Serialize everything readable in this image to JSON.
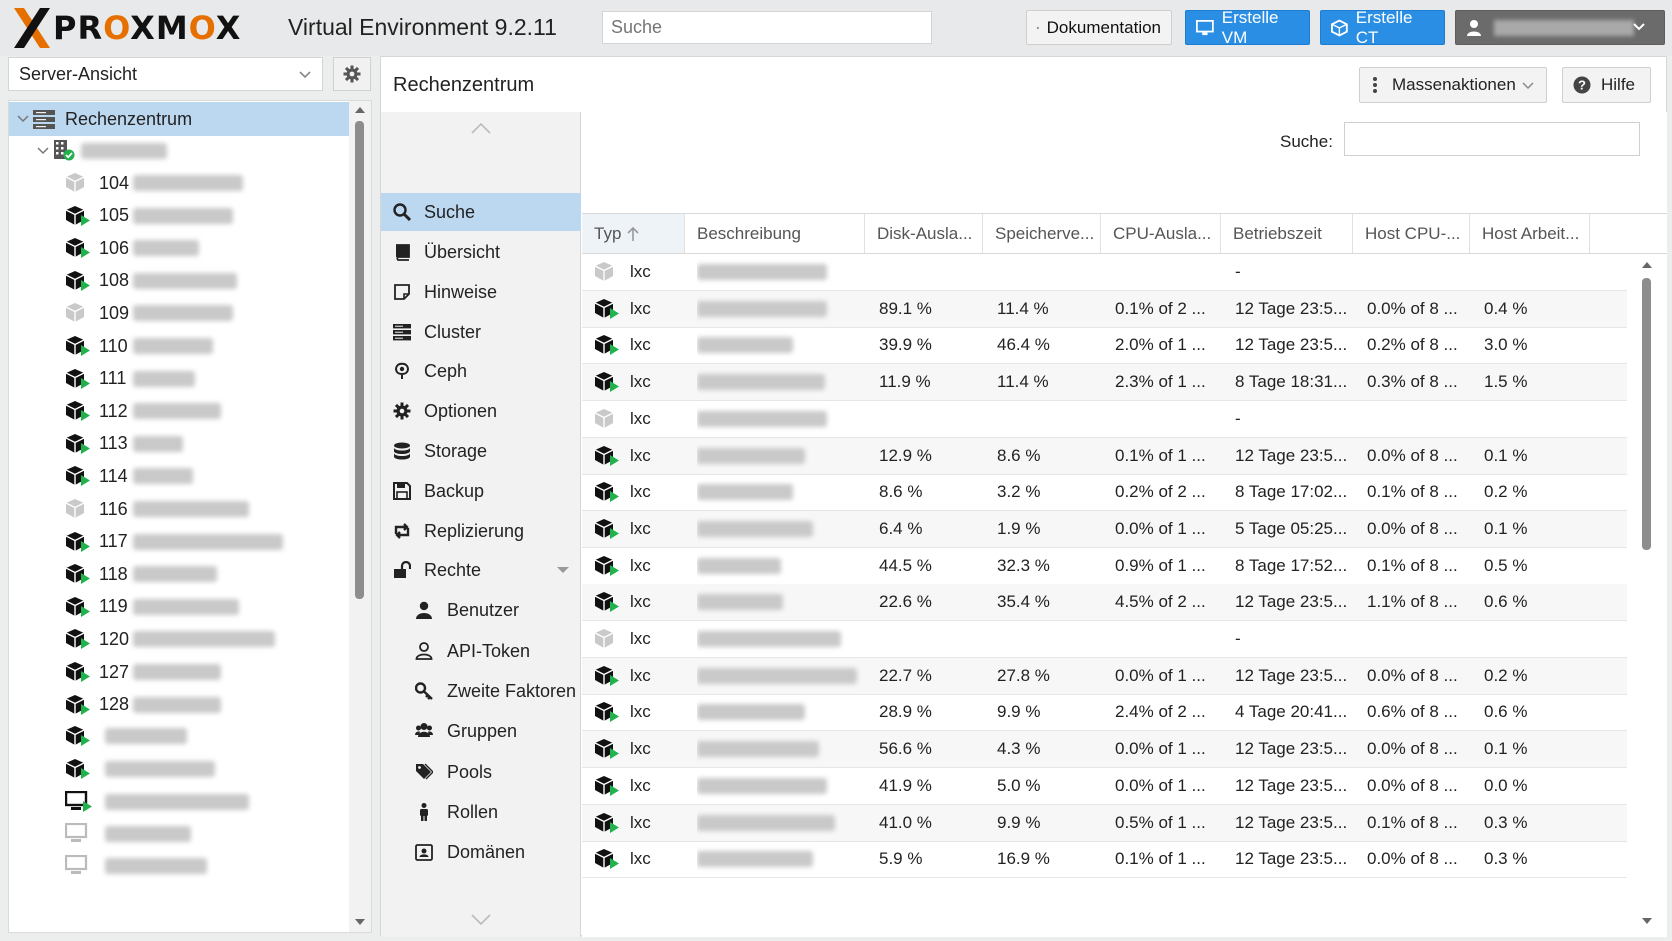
{
  "header": {
    "logo_text_a": "PR",
    "logo_text_o1": "O",
    "logo_text_b": "XM",
    "logo_text_o2": "O",
    "logo_text_c": "X",
    "version": "Virtual Environment 9.2.11",
    "search_placeholder": "Suche",
    "doc_label": "Dokumentation",
    "create_vm_label": "Erstelle VM",
    "create_ct_label": "Erstelle CT"
  },
  "sidebar": {
    "view_label": "Server-Ansicht",
    "tree": {
      "root_label": "Rechenzentrum",
      "containers": [
        {
          "id": "104",
          "running": false
        },
        {
          "id": "105",
          "running": true
        },
        {
          "id": "106",
          "running": true
        },
        {
          "id": "108",
          "running": true
        },
        {
          "id": "109",
          "running": false
        },
        {
          "id": "110",
          "running": true
        },
        {
          "id": "111",
          "running": true
        },
        {
          "id": "112",
          "running": true
        },
        {
          "id": "113",
          "running": true
        },
        {
          "id": "114",
          "running": true
        },
        {
          "id": "116",
          "running": false
        },
        {
          "id": "117",
          "running": true
        },
        {
          "id": "118",
          "running": true
        },
        {
          "id": "119",
          "running": true
        },
        {
          "id": "120",
          "running": true
        },
        {
          "id": "127",
          "running": true
        },
        {
          "id": "128",
          "running": true
        }
      ]
    }
  },
  "content": {
    "title": "Rechenzentrum",
    "bulk_actions_label": "Massenaktionen",
    "help_label": "Hilfe",
    "nav": [
      {
        "label": "Suche",
        "icon": "search-icon",
        "selected": true
      },
      {
        "label": "Übersicht",
        "icon": "book-icon"
      },
      {
        "label": "Hinweise",
        "icon": "note-icon"
      },
      {
        "label": "Cluster",
        "icon": "server-icon"
      },
      {
        "label": "Ceph",
        "icon": "ceph-icon"
      },
      {
        "label": "Optionen",
        "icon": "gear-icon"
      },
      {
        "label": "Storage",
        "icon": "database-icon"
      },
      {
        "label": "Backup",
        "icon": "floppy-icon"
      },
      {
        "label": "Replizierung",
        "icon": "retweet-icon"
      },
      {
        "label": "Rechte",
        "icon": "unlock-icon"
      },
      {
        "label": "Benutzer",
        "icon": "user-icon",
        "sub": true
      },
      {
        "label": "API-Token",
        "icon": "user-outline-icon",
        "sub": true
      },
      {
        "label": "Zweite Faktoren",
        "icon": "key-icon",
        "sub": true
      },
      {
        "label": "Gruppen",
        "icon": "users-icon",
        "sub": true
      },
      {
        "label": "Pools",
        "icon": "tags-icon",
        "sub": true
      },
      {
        "label": "Rollen",
        "icon": "male-icon",
        "sub": true
      },
      {
        "label": "Domänen",
        "icon": "id-card-icon",
        "sub": true
      }
    ],
    "grid": {
      "search_label": "Suche:",
      "columns": [
        "Typ",
        "Beschreibung",
        "Disk-Ausla...",
        "Speicherve...",
        "CPU-Ausla...",
        "Betriebszeit",
        "Host CPU-...",
        "Host Arbeit..."
      ],
      "rows": [
        {
          "type": "lxc",
          "running": false,
          "disk": "",
          "mem": "",
          "cpu": "",
          "uptime": "-",
          "hostcpu": "",
          "hostmem": ""
        },
        {
          "type": "lxc",
          "running": true,
          "disk": "89.1 %",
          "mem": "11.4 %",
          "cpu": "0.1% of 2 ...",
          "uptime": "12 Tage 23:5...",
          "hostcpu": "0.0% of 8 ...",
          "hostmem": "0.4 %"
        },
        {
          "type": "lxc",
          "running": true,
          "disk": "39.9 %",
          "mem": "46.4 %",
          "cpu": "2.0% of 1 ...",
          "uptime": "12 Tage 23:5...",
          "hostcpu": "0.2% of 8 ...",
          "hostmem": "3.0 %"
        },
        {
          "type": "lxc",
          "running": true,
          "disk": "11.9 %",
          "mem": "11.4 %",
          "cpu": "2.3% of 1 ...",
          "uptime": "8 Tage 18:31...",
          "hostcpu": "0.3% of 8 ...",
          "hostmem": "1.5 %"
        },
        {
          "type": "lxc",
          "running": false,
          "disk": "",
          "mem": "",
          "cpu": "",
          "uptime": "-",
          "hostcpu": "",
          "hostmem": ""
        },
        {
          "type": "lxc",
          "running": true,
          "disk": "12.9 %",
          "mem": "8.6 %",
          "cpu": "0.1% of 1 ...",
          "uptime": "12 Tage 23:5...",
          "hostcpu": "0.0% of 8 ...",
          "hostmem": "0.1 %"
        },
        {
          "type": "lxc",
          "running": true,
          "disk": "8.6 %",
          "mem": "3.2 %",
          "cpu": "0.2% of 2 ...",
          "uptime": "8 Tage 17:02...",
          "hostcpu": "0.1% of 8 ...",
          "hostmem": "0.2 %"
        },
        {
          "type": "lxc",
          "running": true,
          "disk": "6.4 %",
          "mem": "1.9 %",
          "cpu": "0.0% of 1 ...",
          "uptime": "5 Tage 05:25...",
          "hostcpu": "0.0% of 8 ...",
          "hostmem": "0.1 %"
        },
        {
          "type": "lxc",
          "running": true,
          "disk": "44.5 %",
          "mem": "32.3 %",
          "cpu": "0.9% of 1 ...",
          "uptime": "8 Tage 17:52...",
          "hostcpu": "0.1% of 8 ...",
          "hostmem": "0.5 %"
        },
        {
          "type": "lxc",
          "running": true,
          "disk": "22.6 %",
          "mem": "35.4 %",
          "cpu": "4.5% of 2 ...",
          "uptime": "12 Tage 23:5...",
          "hostcpu": "1.1% of 8 ...",
          "hostmem": "0.6 %"
        },
        {
          "type": "lxc",
          "running": false,
          "disk": "",
          "mem": "",
          "cpu": "",
          "uptime": "-",
          "hostcpu": "",
          "hostmem": ""
        },
        {
          "type": "lxc",
          "running": true,
          "disk": "22.7 %",
          "mem": "27.8 %",
          "cpu": "0.0% of 1 ...",
          "uptime": "12 Tage 23:5...",
          "hostcpu": "0.0% of 8 ...",
          "hostmem": "0.2 %"
        },
        {
          "type": "lxc",
          "running": true,
          "disk": "28.9 %",
          "mem": "9.9 %",
          "cpu": "2.4% of 2 ...",
          "uptime": "4 Tage 20:41...",
          "hostcpu": "0.6% of 8 ...",
          "hostmem": "0.6 %"
        },
        {
          "type": "lxc",
          "running": true,
          "disk": "56.6 %",
          "mem": "4.3 %",
          "cpu": "0.0% of 1 ...",
          "uptime": "12 Tage 23:5...",
          "hostcpu": "0.0% of 8 ...",
          "hostmem": "0.1 %"
        },
        {
          "type": "lxc",
          "running": true,
          "disk": "41.9 %",
          "mem": "5.0 %",
          "cpu": "0.0% of 1 ...",
          "uptime": "12 Tage 23:5...",
          "hostcpu": "0.0% of 8 ...",
          "hostmem": "0.0 %"
        },
        {
          "type": "lxc",
          "running": true,
          "disk": "41.0 %",
          "mem": "9.9 %",
          "cpu": "0.5% of 1 ...",
          "uptime": "12 Tage 23:5...",
          "hostcpu": "0.1% of 8 ...",
          "hostmem": "0.3 %"
        },
        {
          "type": "lxc",
          "running": true,
          "disk": "5.9 %",
          "mem": "16.9 %",
          "cpu": "0.1% of 1 ...",
          "uptime": "12 Tage 23:5...",
          "hostcpu": "0.0% of 8 ...",
          "hostmem": "0.3 %"
        }
      ]
    }
  },
  "colors": {
    "accent_blue": "#2a8ee4",
    "selection": "#bcd8f1",
    "running_green": "#21b14d",
    "brand_orange": "#e57000"
  }
}
